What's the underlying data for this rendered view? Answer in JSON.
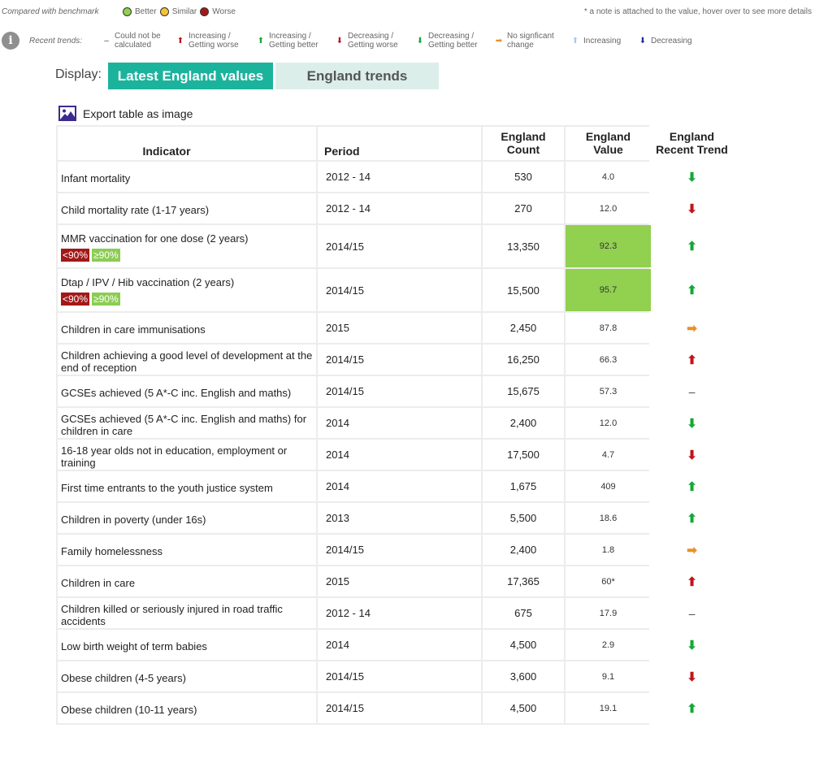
{
  "benchmark": {
    "compared_label": "Compared with benchmark",
    "better_label": "Better",
    "similar_label": "Similar",
    "worse_label": "Worse",
    "colors": {
      "better": "#92d050",
      "similar": "#f5c335",
      "worse": "#c0141a"
    },
    "note": "* a note is attached to the value, hover over to see more details"
  },
  "trends_legend": {
    "label": "Recent trends:",
    "items": [
      {
        "icon": "dash-icon",
        "text": "Could not be calculated"
      },
      {
        "icon": "arrow-up-red-icon",
        "text": "Increasing / Getting worse"
      },
      {
        "icon": "arrow-up-green-icon",
        "text": "Increasing / Getting better"
      },
      {
        "icon": "arrow-down-red-icon",
        "text": "Decreasing / Getting worse"
      },
      {
        "icon": "arrow-down-green-icon",
        "text": "Decreasing / Getting better"
      },
      {
        "icon": "arrow-right-orange-icon",
        "text": "No signficant change"
      },
      {
        "icon": "arrow-up-lightblue-icon",
        "text": "Increasing"
      },
      {
        "icon": "arrow-down-darkblue-icon",
        "text": "Decreasing"
      }
    ]
  },
  "display": {
    "label": "Display:",
    "tabs": [
      {
        "label": "Latest England values",
        "active": true
      },
      {
        "label": "England trends",
        "active": false
      }
    ]
  },
  "export_label": "Export table as image",
  "table": {
    "headers": {
      "indicator": "Indicator",
      "period": "Period",
      "count_line1": "England",
      "count_line2": "Count",
      "value_line1": "England",
      "value_line2": "Value",
      "trend_line1": "England",
      "trend_line2": "Recent Trend"
    },
    "badge_low": "<90%",
    "badge_high": "≥90%",
    "rows": [
      {
        "indicator": "Infant mortality",
        "period": "2012 - 14",
        "count": "530",
        "value": "4.0",
        "trend": "arrow-down-green-icon"
      },
      {
        "indicator": "Child mortality rate (1-17 years)",
        "period": "2012 - 14",
        "count": "270",
        "value": "12.0",
        "trend": "arrow-down-red-icon"
      },
      {
        "indicator": "MMR vaccination for one dose (2 years)",
        "period": "2014/15",
        "count": "13,350",
        "value": "92.3",
        "trend": "arrow-up-green-icon",
        "benchmark": "better"
      },
      {
        "indicator": "Dtap / IPV / Hib vaccination (2 years)",
        "period": "2014/15",
        "count": "15,500",
        "value": "95.7",
        "trend": "arrow-up-green-icon",
        "benchmark": "better"
      },
      {
        "indicator": "Children in care immunisations",
        "period": "2015",
        "count": "2,450",
        "value": "87.8",
        "trend": "arrow-right-orange-icon"
      },
      {
        "indicator": "Children achieving a good level of development at the end of reception",
        "period": "2014/15",
        "count": "16,250",
        "value": "66.3",
        "trend": "arrow-up-red-icon"
      },
      {
        "indicator": "GCSEs achieved (5 A*-C inc. English and maths)",
        "period": "2014/15",
        "count": "15,675",
        "value": "57.3",
        "trend": "dash-icon"
      },
      {
        "indicator": "GCSEs achieved (5 A*-C inc. English and maths) for children in care",
        "period": "2014",
        "count": "2,400",
        "value": "12.0",
        "trend": "arrow-down-green-icon"
      },
      {
        "indicator": "16-18 year olds not in education, employment or training",
        "period": "2014",
        "count": "17,500",
        "value": "4.7",
        "trend": "arrow-down-red-icon"
      },
      {
        "indicator": "First time entrants to the youth justice system",
        "period": "2014",
        "count": "1,675",
        "value": "409",
        "trend": "arrow-up-green-icon"
      },
      {
        "indicator": "Children in poverty (under 16s)",
        "period": "2013",
        "count": "5,500",
        "value": "18.6",
        "trend": "arrow-up-green-icon"
      },
      {
        "indicator": "Family homelessness",
        "period": "2014/15",
        "count": "2,400",
        "value": "1.8",
        "trend": "arrow-right-orange-icon"
      },
      {
        "indicator": "Children in care",
        "period": "2015",
        "count": "17,365",
        "value": "60*",
        "trend": "arrow-up-red-icon"
      },
      {
        "indicator": "Children killed or seriously injured in road traffic accidents",
        "period": "2012 - 14",
        "count": "675",
        "value": "17.9",
        "trend": "dash-icon"
      },
      {
        "indicator": "Low birth weight of term babies",
        "period": "2014",
        "count": "4,500",
        "value": "2.9",
        "trend": "arrow-down-green-icon"
      },
      {
        "indicator": "Obese children (4-5 years)",
        "period": "2014/15",
        "count": "3,600",
        "value": "9.1",
        "trend": "arrow-down-red-icon"
      },
      {
        "indicator": "Obese children (10-11 years)",
        "period": "2014/15",
        "count": "4,500",
        "value": "19.1",
        "trend": "arrow-up-green-icon"
      }
    ]
  }
}
